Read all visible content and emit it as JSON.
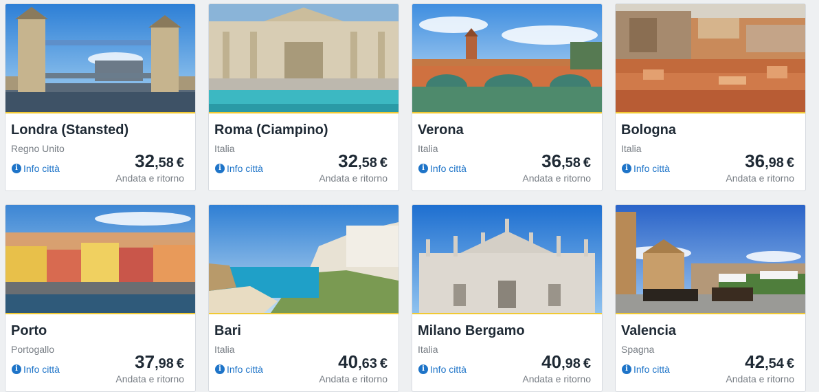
{
  "info_label": "Info città",
  "destinations": [
    {
      "city": "Londra (Stansted)",
      "country": "Regno Unito",
      "price_int": "32",
      "price_dec": ",58",
      "currency": "€",
      "trip": "Andata e ritorno",
      "photo": "tower-bridge-image"
    },
    {
      "city": "Roma (Ciampino)",
      "country": "Italia",
      "price_int": "32",
      "price_dec": ",58",
      "currency": "€",
      "trip": "Andata e ritorno",
      "photo": "trevi-fountain-image"
    },
    {
      "city": "Verona",
      "country": "Italia",
      "price_int": "36",
      "price_dec": ",58",
      "currency": "€",
      "trip": "Andata e ritorno",
      "photo": "verona-bridge-image"
    },
    {
      "city": "Bologna",
      "country": "Italia",
      "price_int": "36",
      "price_dec": ",98",
      "currency": "€",
      "trip": "Andata e ritorno",
      "photo": "bologna-rooftops-image"
    },
    {
      "city": "Porto",
      "country": "Portogallo",
      "price_int": "37",
      "price_dec": ",98",
      "currency": "€",
      "trip": "Andata e ritorno",
      "photo": "porto-riverside-image"
    },
    {
      "city": "Bari",
      "country": "Italia",
      "price_int": "40",
      "price_dec": ",63",
      "currency": "€",
      "trip": "Andata e ritorno",
      "photo": "polignano-coast-image"
    },
    {
      "city": "Milano Bergamo",
      "country": "Italia",
      "price_int": "40",
      "price_dec": ",98",
      "currency": "€",
      "trip": "Andata e ritorno",
      "photo": "milan-cathedral-image"
    },
    {
      "city": "Valencia",
      "country": "Spagna",
      "price_int": "42",
      "price_dec": ",54",
      "currency": "€",
      "trip": "Andata e ritorno",
      "photo": "valencia-plaza-image"
    }
  ]
}
